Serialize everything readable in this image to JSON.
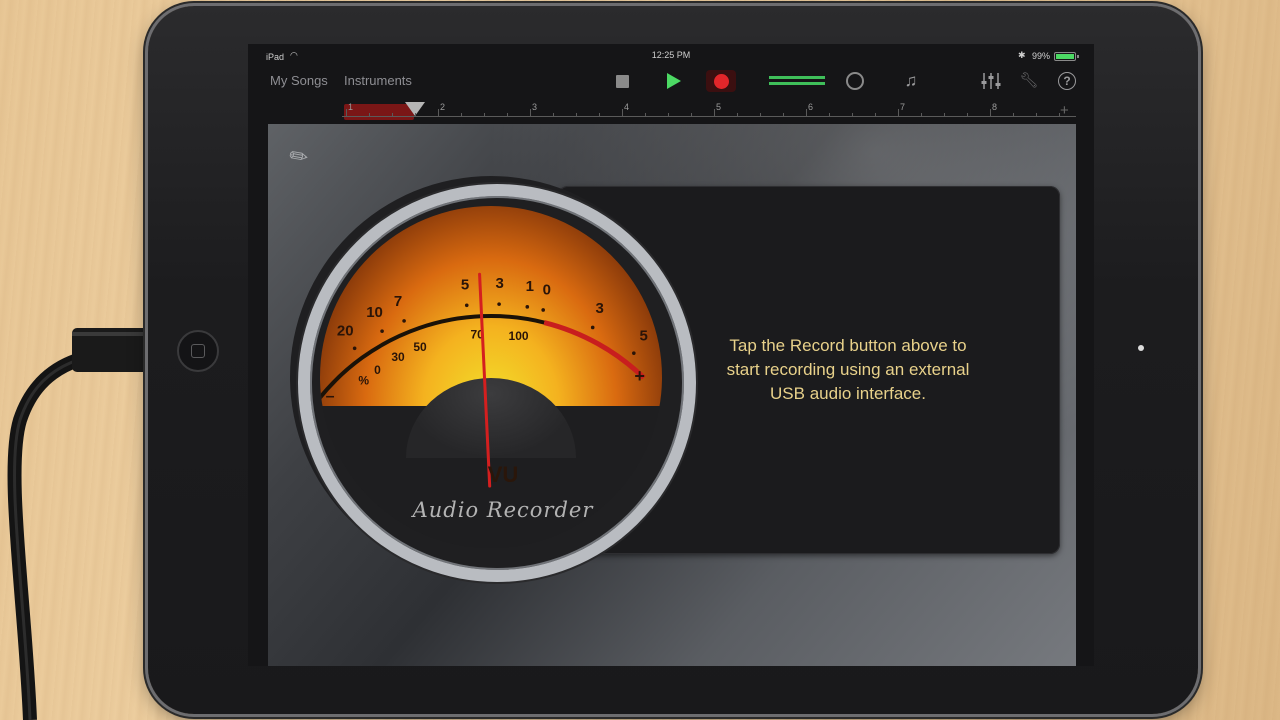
{
  "status_bar": {
    "device": "iPad",
    "time": "12:25 PM",
    "battery": "99%",
    "battery_level": 0.99
  },
  "toolbar": {
    "my_songs": "My Songs",
    "instruments": "Instruments",
    "icons": {
      "stop": "stop-icon",
      "play": "play-icon",
      "record": "record-icon",
      "metronome": "metronome-icon",
      "loop": "loop-browser-icon",
      "mixer": "mixer-icon",
      "settings": "wrench-icon",
      "help": "help-icon"
    },
    "help_glyph": "?"
  },
  "ruler": {
    "bars": [
      "1",
      "2",
      "3",
      "4",
      "5",
      "6",
      "7",
      "8"
    ],
    "add_section": "+"
  },
  "vu_meter": {
    "upper_scale": [
      "20",
      "10",
      "7",
      "5",
      "3",
      "1",
      "0",
      "3",
      "5"
    ],
    "lower_scale": [
      "%",
      "0",
      "30",
      "50",
      "70",
      "100"
    ],
    "minus": "–",
    "plus": "+",
    "title": "VU",
    "label": "Audio Recorder"
  },
  "message": {
    "line1": "Tap the Record button above to",
    "line2": "start recording using an external",
    "line3": "USB audio interface."
  },
  "colors": {
    "accent_green": "#4cd964",
    "record_red": "#e2262a",
    "message_text": "#e8d18a",
    "needle": "#d41f1f"
  }
}
